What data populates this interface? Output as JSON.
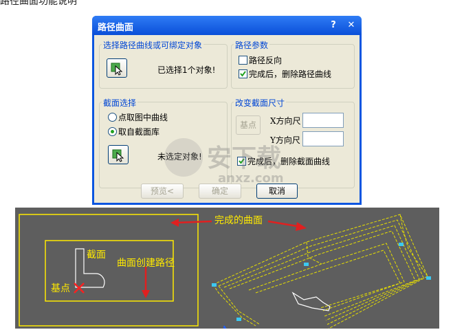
{
  "dialog": {
    "title": "路径曲面",
    "help_btn": "?",
    "close_btn": "✕",
    "select_group": {
      "label": "选择路径曲线或可绑定对象",
      "status": "已选择1个对象!"
    },
    "path_params": {
      "label": "路径参数",
      "reverse_label": "路径反向",
      "reverse_checked": false,
      "delete_label": "完成后，删除路径曲线",
      "delete_checked": true
    },
    "section_select": {
      "label": "截面选择",
      "option1": "点取图中曲线",
      "option2": "取自截面库",
      "selected": "取自截面库",
      "status": "未选定对象!"
    },
    "section_size": {
      "label": "改变截面尺寸",
      "base_btn": "基点",
      "x_label": "X方向尺",
      "y_label": "Y方向尺",
      "x_value": "",
      "y_value": "",
      "delete_label": "完成后，删除截面曲线",
      "delete_checked": true
    },
    "buttons": {
      "preview": "预览<",
      "ok": "确定",
      "cancel": "取消"
    }
  },
  "watermark": {
    "text1": "安下载",
    "text2": "anxz.com"
  },
  "illustration": {
    "result_label": "完成的曲面",
    "section_label": "截面",
    "path_label": "曲面创建路径",
    "base_label": "基点"
  },
  "colors": {
    "title_blue": "#0a55e0",
    "group_text": "#0046d5",
    "annotation_yellow": "#ffea00",
    "arrow_red": "#e02020",
    "illus_bg": "#5e5e5e"
  }
}
